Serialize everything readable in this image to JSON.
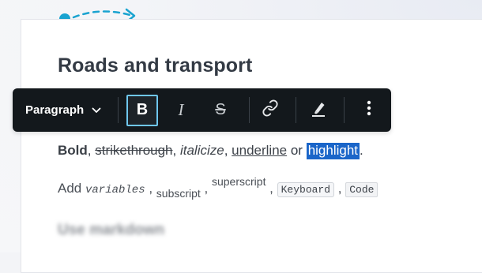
{
  "editor": {
    "heading": "Roads and transport",
    "blurred_heading": "Use markdown"
  },
  "toolbar": {
    "style_label": "Paragraph",
    "buttons": [
      {
        "name": "bold",
        "icon": "bold-icon",
        "glyph": "B",
        "active": true
      },
      {
        "name": "italic",
        "icon": "italic-icon",
        "glyph": "I",
        "active": false
      },
      {
        "name": "strikethrough",
        "icon": "strikethrough-icon",
        "glyph": "S",
        "active": false
      },
      {
        "name": "link",
        "icon": "link-icon",
        "active": false
      },
      {
        "name": "highlight",
        "icon": "highlighter-icon",
        "active": false
      },
      {
        "name": "more",
        "icon": "more-vertical-icon",
        "active": false
      }
    ]
  },
  "line1": {
    "bold": "Bold",
    "sep1": ", ",
    "strike": "strikethrough",
    "sep2": ", ",
    "italic": "italicize",
    "sep3": ", ",
    "underline": "underline",
    "or": " or ",
    "highlight": "highlight",
    "end": "."
  },
  "line2": {
    "add": "Add ",
    "variable": "variables",
    "sep1": " , ",
    "subscript": "subscript",
    "sep2": " , ",
    "superscript": "superscript",
    "sep3": " , ",
    "keyboard": "Keyboard",
    "sep4": " , ",
    "code": "Code"
  },
  "colors": {
    "toolbar_bg": "#13181c",
    "active_outline": "#6fc7ee",
    "highlight_bg": "#1b66c9",
    "accent_dot": "#1aa3d0"
  }
}
